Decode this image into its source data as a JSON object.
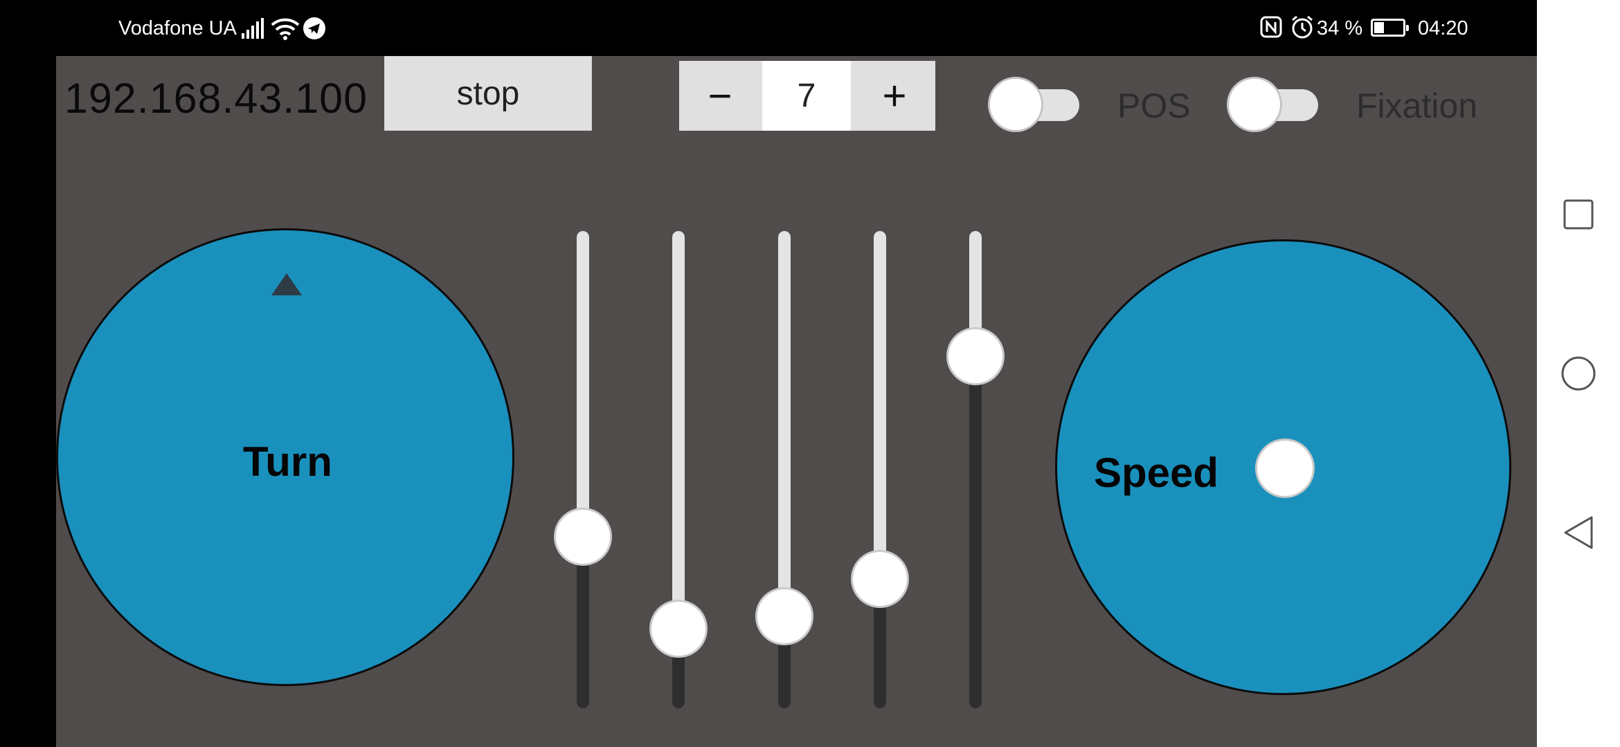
{
  "status_bar": {
    "carrier": "Vodafone UA",
    "battery_percent": "34 %",
    "time": "04:20",
    "icons": [
      "signal-icon",
      "wifi-icon",
      "telegram-icon",
      "nfc-icon",
      "alarm-icon",
      "battery-charging-icon"
    ]
  },
  "header": {
    "ip_address": "192.168.43.100",
    "stop_label": "stop",
    "stepper": {
      "minus": "−",
      "value": "7",
      "plus": "+"
    },
    "toggles": [
      {
        "label": "POS",
        "on": false
      },
      {
        "label": "Fixation",
        "on": false
      }
    ]
  },
  "joysticks": {
    "turn": {
      "label": "Turn",
      "color": "#1a90bd"
    },
    "speed": {
      "label": "Speed",
      "color": "#1a90bd"
    }
  },
  "sliders": [
    {
      "value_fraction": 0.34
    },
    {
      "value_fraction": 0.12
    },
    {
      "value_fraction": 0.15
    },
    {
      "value_fraction": 0.24
    },
    {
      "value_fraction": 0.77
    }
  ],
  "nav_bar": {
    "icons": [
      "recents-square-icon",
      "home-circle-icon",
      "back-triangle-icon"
    ]
  },
  "colors": {
    "app_background": "#504c4b",
    "joystick_fill": "#1a90bd",
    "status_bar": "#000000"
  }
}
